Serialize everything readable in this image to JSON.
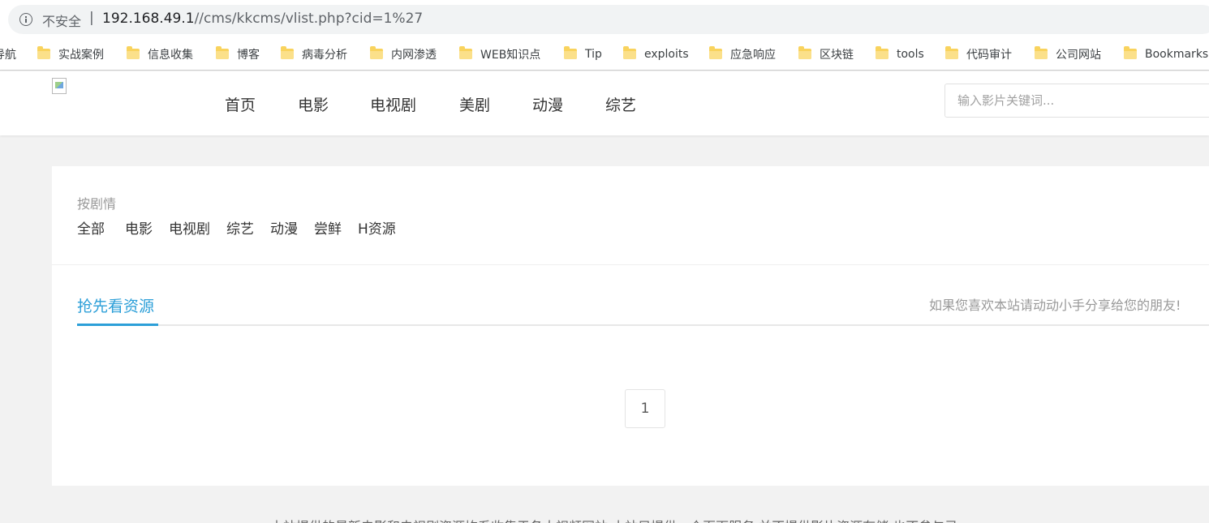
{
  "address_bar": {
    "security_label": "不安全",
    "separator": "|",
    "url_host": "192.168.49.1",
    "url_path": "//cms/kkcms/vlist.php?cid=1%27"
  },
  "bookmarks": [
    {
      "label": "导航",
      "icon": "folder-icon"
    },
    {
      "label": "实战案例",
      "icon": "folder-icon"
    },
    {
      "label": "信息收集",
      "icon": "folder-icon"
    },
    {
      "label": "博客",
      "icon": "folder-icon"
    },
    {
      "label": "病毒分析",
      "icon": "folder-icon"
    },
    {
      "label": "内网渗透",
      "icon": "folder-icon"
    },
    {
      "label": "WEB知识点",
      "icon": "folder-icon"
    },
    {
      "label": "Tip",
      "icon": "folder-icon"
    },
    {
      "label": "exploits",
      "icon": "folder-icon"
    },
    {
      "label": "应急响应",
      "icon": "folder-icon"
    },
    {
      "label": "区块链",
      "icon": "folder-icon"
    },
    {
      "label": "tools",
      "icon": "folder-icon"
    },
    {
      "label": "代码审计",
      "icon": "folder-icon"
    },
    {
      "label": "公司网站",
      "icon": "folder-icon"
    },
    {
      "label": "Bookmarks",
      "icon": "folder-icon"
    }
  ],
  "site_header": {
    "nav": [
      "首页",
      "电影",
      "电视剧",
      "美剧",
      "动漫",
      "综艺"
    ],
    "search_placeholder": "输入影片关键词..."
  },
  "content": {
    "filter_title": "按剧情",
    "filters": [
      "全部",
      "电影",
      "电视剧",
      "综艺",
      "动漫",
      "尝鲜",
      "H资源"
    ],
    "active_tab": "抢先看资源",
    "share_text": "如果您喜欢本站请动动小手分享给您的朋友!",
    "pagination": [
      "1"
    ]
  },
  "footer": {
    "text": "本站提供的最新电影和电视剧资源均系收集于各大视频网站,本站只提供一个页面服务,并不提供影片资源存储,也不参与录"
  },
  "colors": {
    "accent": "#2c9fd8",
    "page_background": "#f2f2f2",
    "folder": "#f9d35d"
  }
}
